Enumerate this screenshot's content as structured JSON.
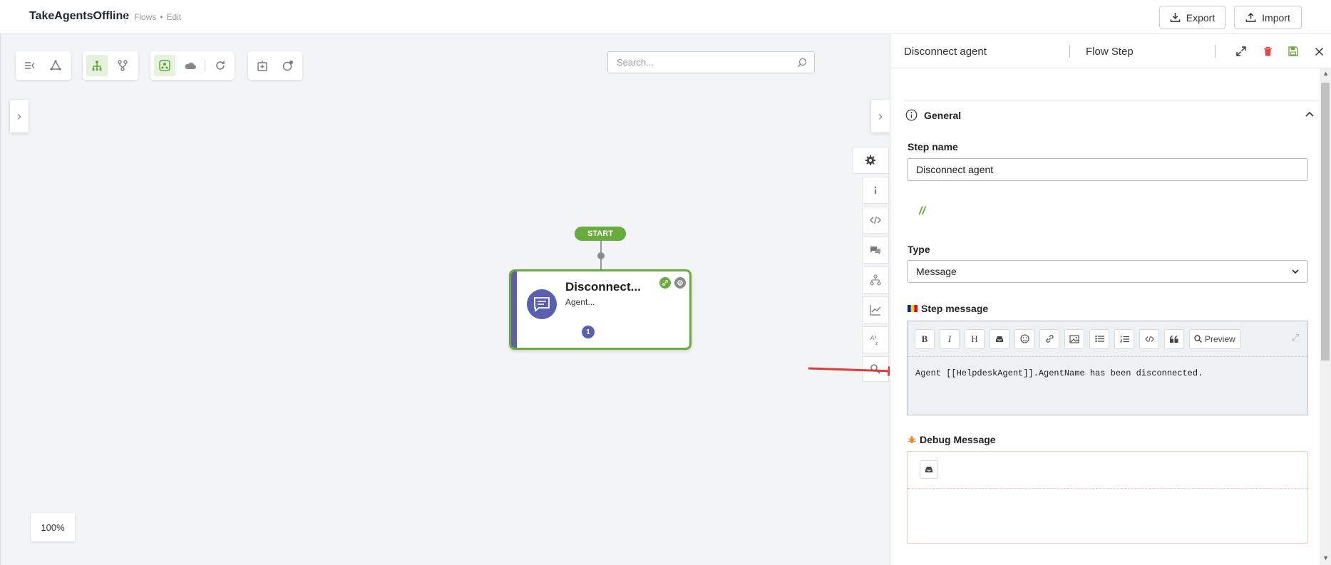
{
  "header": {
    "app_title": "TakeAgentsOffline",
    "breadcrumb": [
      "Flows",
      "Edit"
    ],
    "export_label": "Export",
    "import_label": "Import"
  },
  "canvas": {
    "search_placeholder": "Search...",
    "zoom_level": "100%",
    "toolbar_groups": [
      [
        "collapse-menu-icon",
        "nodes-icon"
      ],
      [
        "tree-layout-icon",
        "branch-icon"
      ],
      [
        "group-active-icon",
        "cloud-icon",
        "refresh-icon"
      ],
      [
        "add-node-icon",
        "add-circle-icon"
      ]
    ]
  },
  "flow": {
    "start_label": "START",
    "node": {
      "title": "Disconnect...",
      "subtitle": "Agent...",
      "badge": "1"
    }
  },
  "side_tools": [
    "gear-icon",
    "info-icon",
    "code-icon",
    "chat-icon",
    "hierarchy-icon",
    "chart-icon",
    "translate-icon",
    "search-icon"
  ],
  "panel": {
    "title": "Disconnect agent",
    "subtitle": "Flow Step",
    "section_general": "General",
    "step_name_label": "Step name",
    "step_name_value": "Disconnect agent",
    "comment_mark": "//",
    "type_label": "Type",
    "type_value": "Message",
    "step_message_label": "Step message",
    "editor_toolbar": [
      "B",
      "I",
      "H"
    ],
    "preview_label": "Preview",
    "message_text": "Agent [[HelpdeskAgent]].AgentName has been disconnected.",
    "debug_label": "Debug Message"
  },
  "colors": {
    "accent_green": "#6aab3f",
    "node_purple": "#5b5fb0",
    "delete_red": "#e04848",
    "arrow_red": "#e03b3b"
  }
}
